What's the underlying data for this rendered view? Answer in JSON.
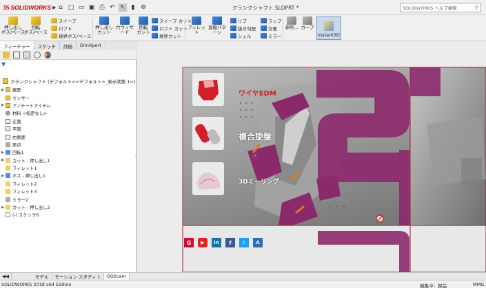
{
  "app": {
    "brand_ds": "3S",
    "brand_name": "SOLIDWORKS",
    "document_title": "クランクシャフト.SLDPRT *",
    "search_placeholder": "SOLIDWORKS ヘルプ検索"
  },
  "commands": {
    "extrude_boss": "押し出し\nボス/ベース",
    "revolve_boss": "回転\nボス/ベース",
    "sweep": "スイープ",
    "loft": "ロフト",
    "boundary_boss": "境界ボス/ベース",
    "extrude_cut": "押し出し\nカット",
    "hole_wizard": "穴ウィザード",
    "revolve_cut": "回転\nカット",
    "swept_cut": "スイープ カット",
    "lofted_cut": "ロフト カット",
    "boundary_cut": "境界カット",
    "fillet": "フィレット",
    "linear_pattern": "直線パターン",
    "rib": "リブ",
    "draft": "抜き勾配",
    "shell": "シェル",
    "wrap": "ラップ",
    "intersect": "交差",
    "mirror": "ミラー",
    "reference": "参照...",
    "curves": "カーブ",
    "instant3d": "Instant3D"
  },
  "cmd_tabs": [
    "フィーチャー",
    "スケッチ",
    "評価",
    "DimXpert"
  ],
  "tree": {
    "root": "クランクシャフト (デフォルト<<デフォルト>_表示状態 1>)",
    "items": [
      {
        "label": "履歴",
        "icon": "f",
        "arrow": true
      },
      {
        "label": "センサー",
        "icon": "f",
        "arrow": false
      },
      {
        "label": "アノテートアイテム",
        "icon": "f",
        "arrow": true
      },
      {
        "label": "材料 <指定なし>",
        "icon": "m",
        "arrow": false
      },
      {
        "label": "正面",
        "icon": "p",
        "arrow": false
      },
      {
        "label": "平面",
        "icon": "p",
        "arrow": false
      },
      {
        "label": "右側面",
        "icon": "p",
        "arrow": false
      },
      {
        "label": "原点",
        "icon": "g",
        "arrow": false
      },
      {
        "label": "回転1",
        "icon": "b",
        "arrow": true
      },
      {
        "label": "カット - 押し出し1",
        "icon": "y",
        "arrow": true
      },
      {
        "label": "フィレット1",
        "icon": "y",
        "arrow": false
      },
      {
        "label": "ボス - 押し出し1",
        "icon": "b",
        "arrow": true
      },
      {
        "label": "フィレット2",
        "icon": "y",
        "arrow": false
      },
      {
        "label": "フィレット3",
        "icon": "y",
        "arrow": false
      },
      {
        "label": "ミラー2",
        "icon": "g",
        "arrow": false
      },
      {
        "label": "カット - 押し出し2",
        "icon": "y",
        "arrow": true
      },
      {
        "label": "(-) スケッチ6",
        "icon": "s",
        "arrow": false
      }
    ]
  },
  "graphics": {
    "wire_edm": "ワイヤEDM",
    "composite_lathe": "複合旋盤",
    "milling_3d": "3Dミーリング",
    "social": [
      "GO2cam",
      "YouTube",
      "LinkedIn",
      "Facebook",
      "Twitter",
      "Other"
    ]
  },
  "bottom_tabs": [
    "モデル",
    "モーション スタディ 1",
    "GO2cam"
  ],
  "status": {
    "edition": "SOLIDWORKS 2018 x64 Edition",
    "editing": "編集中：部品",
    "units": "MMG"
  }
}
